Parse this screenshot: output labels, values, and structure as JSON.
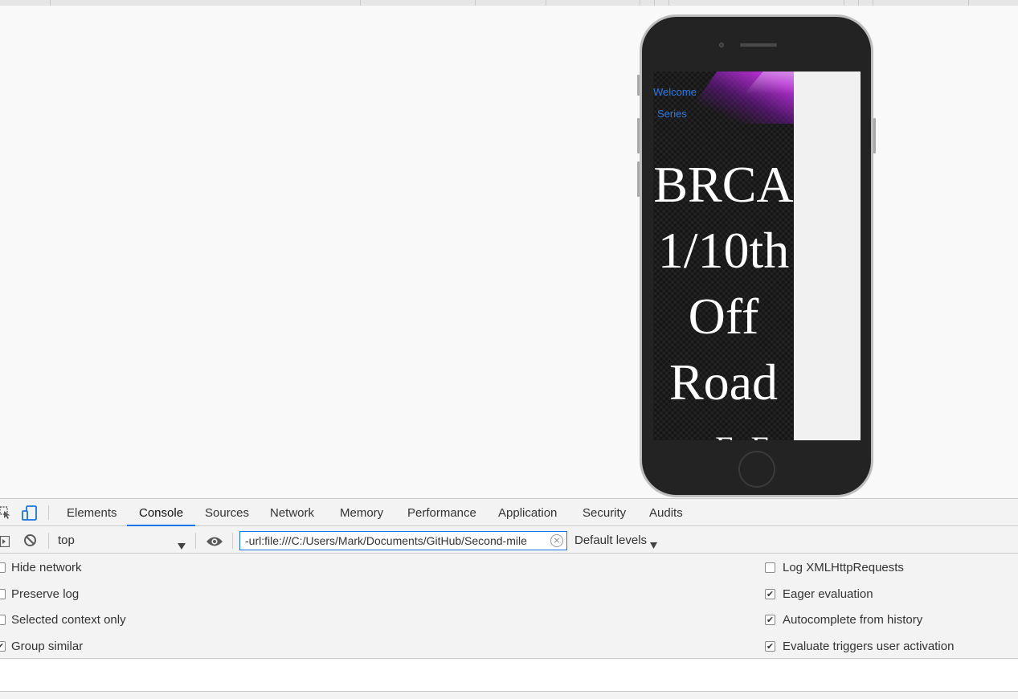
{
  "preview": {
    "nav": {
      "welcome": "Welcome",
      "series": "Series"
    },
    "hero_lines": [
      "BRCA",
      "1/10th",
      "Off",
      "Road",
      "EoE"
    ],
    "colors": {
      "accent_link": "#2a7ae2",
      "swoosh": "#c23be0"
    }
  },
  "devtools": {
    "tabs": [
      "Elements",
      "Console",
      "Sources",
      "Network",
      "Memory",
      "Performance",
      "Application",
      "Security",
      "Audits"
    ],
    "active_tab": "Console",
    "context": "top",
    "filter_value": "-url:file:///C:/Users/Mark/Documents/GitHub/Second-mile",
    "levels": "Default levels",
    "options_left": [
      {
        "label": "Hide network",
        "checked": false
      },
      {
        "label": "Preserve log",
        "checked": false
      },
      {
        "label": "Selected context only",
        "checked": false
      },
      {
        "label": "Group similar",
        "checked": true
      }
    ],
    "options_right": [
      {
        "label": "Log XMLHttpRequests",
        "checked": false
      },
      {
        "label": "Eager evaluation",
        "checked": true
      },
      {
        "label": "Autocomplete from history",
        "checked": true
      },
      {
        "label": "Evaluate triggers user activation",
        "checked": true
      }
    ],
    "icons": {
      "inspect": "inspect-element-icon",
      "device": "device-toolbar-icon",
      "sidebar": "console-sidebar-icon",
      "clear": "clear-console-icon",
      "eye": "live-expression-icon",
      "dropdown": "chevron-down-icon",
      "check": "✔"
    },
    "accent": "#1a73e8"
  }
}
